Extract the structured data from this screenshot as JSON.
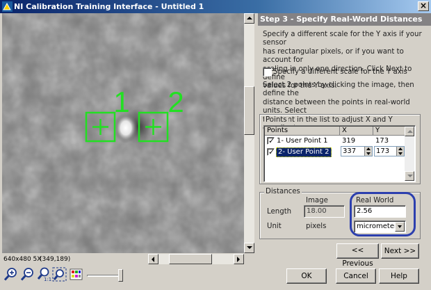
{
  "window": {
    "title": "NI Calibration Training Interface - Untitled 1",
    "close_glyph": "×"
  },
  "viewer": {
    "markers": [
      {
        "label": "1"
      },
      {
        "label": "2"
      }
    ],
    "image_info": "640x480 5X",
    "cursor_coords": "(349,189)",
    "marker_color": "#22e022"
  },
  "toolbar": {
    "tools": [
      "zoom-in-icon",
      "zoom-out-icon",
      "zoom-1to1-icon",
      "zoom-fit-icon",
      "palette-icon"
    ]
  },
  "step": {
    "header": "Step 3 - Specify Real-World Distances",
    "description_lines": [
      "Specify a different scale for the Y axis if your sensor",
      "has rectangular pixels, or if you want to account for",
      "scaling in only one direction. Click Next to define",
      "values for the Y axis."
    ],
    "y_scale_checkbox_label": "Specify a different scale for the Y axis",
    "y_scale_checked": false,
    "instruction_lines": [
      "Select 2 points by clicking the image, then define the",
      "distance between the points in real-world units. Select",
      "the point in the list to adjust X and Y coordinates."
    ]
  },
  "points": {
    "group_label": "Points",
    "columns": [
      "Points",
      "X",
      "Y"
    ],
    "rows": [
      {
        "name": "1- User Point 1",
        "x": "319",
        "y": "173",
        "checked": true,
        "selected": false
      },
      {
        "name": "2- User Point 2",
        "x": "337",
        "y": "173",
        "checked": true,
        "selected": true
      }
    ]
  },
  "distances": {
    "group_label": "Distances",
    "image_header": "Image",
    "real_world_header": "Real World",
    "length_label": "Length",
    "length_image": "18.00",
    "length_real": "2.56",
    "unit_label": "Unit",
    "unit_image": "pixels",
    "unit_real": "micrometer",
    "highlight_color": "#2c3fae"
  },
  "nav": {
    "previous_label": "<< Previous",
    "next_label": "Next >>"
  },
  "buttons": {
    "ok_label": "OK",
    "cancel_label": "Cancel",
    "help_label": "Help"
  }
}
